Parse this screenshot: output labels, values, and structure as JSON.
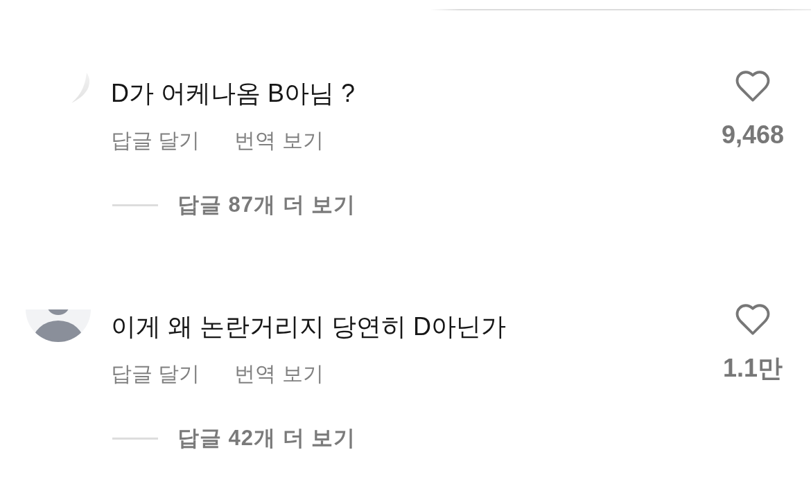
{
  "comments": [
    {
      "avatar": {
        "kind": "partial"
      },
      "text": "D가 어케나옴 B아님 ?",
      "actions": [
        "답글 달기",
        "번역 보기"
      ],
      "replies": "답글 87개 더 보기",
      "liked": false,
      "likes": "9,468"
    },
    {
      "avatar": {
        "kind": "silhouette"
      },
      "text": "이게 왜 논란거리지 당연히 D아닌가",
      "actions": [
        "답글 달기",
        "번역 보기"
      ],
      "replies": "답글 42개 더 보기",
      "liked": false,
      "likes": "1.1만"
    }
  ]
}
